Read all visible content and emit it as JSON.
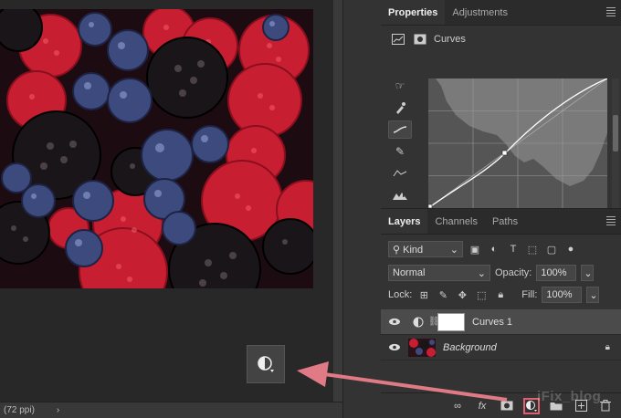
{
  "status": {
    "ppi": "(72 ppi)",
    "chevron": "›"
  },
  "properties_panel": {
    "tabs": [
      {
        "label": "Properties",
        "active": true
      },
      {
        "label": "Adjustments",
        "active": false
      }
    ],
    "header_title": "Curves",
    "tool_icons": [
      "hand-scrub-icon",
      "eyedropper-black-icon",
      "curve-point-icon",
      "pencil-icon",
      "smooth-icon",
      "clip-warning-icon"
    ],
    "action_icons": [
      "clip-layer-icon",
      "view-previous-icon",
      "reset-icon",
      "visibility-icon",
      "trash-icon"
    ]
  },
  "layers_panel": {
    "tabs": [
      {
        "label": "Layers",
        "active": true
      },
      {
        "label": "Channels",
        "active": false
      },
      {
        "label": "Paths",
        "active": false
      }
    ],
    "filter_value": "Kind",
    "blend_mode": "Normal",
    "opacity_label": "Opacity:",
    "opacity_value": "100%",
    "lock_label": "Lock:",
    "fill_label": "Fill:",
    "fill_value": "100%",
    "layers": [
      {
        "name": "Curves 1",
        "selected": true,
        "italic": false
      },
      {
        "name": "Background",
        "selected": false,
        "italic": true
      }
    ],
    "footer_icons": [
      "link-icon",
      "fx-icon",
      "mask-icon",
      "adjustment-layer-icon",
      "group-icon",
      "new-layer-icon",
      "trash-icon"
    ],
    "fx_label": "fx"
  },
  "watermark": "iFix_blog",
  "colors": {
    "highlight": "#e06070",
    "panel_bg": "#333333",
    "arrow": "#e07a85"
  }
}
